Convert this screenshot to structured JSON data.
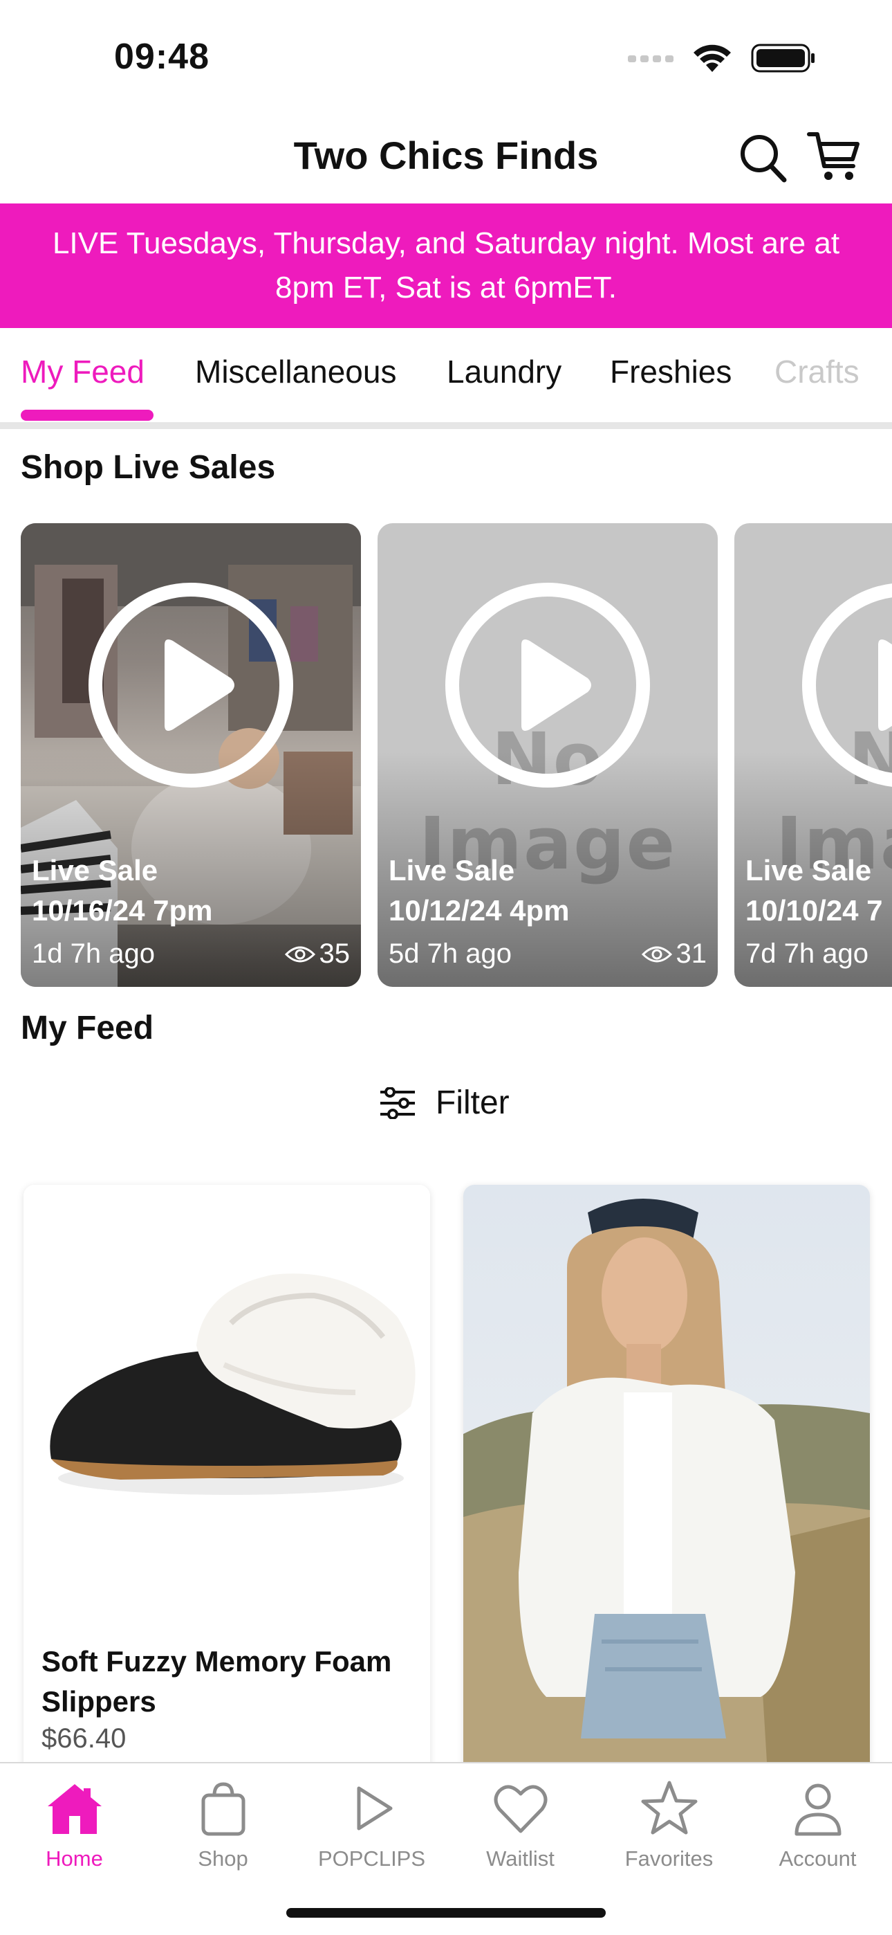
{
  "status_bar": {
    "time": "09:48"
  },
  "header": {
    "title": "Two Chics Finds"
  },
  "banner": {
    "text": "LIVE Tuesdays, Thursday, and Saturday night. Most are at 8pm ET, Sat is at 6pmET."
  },
  "tabs": [
    {
      "label": "My Feed",
      "active": true
    },
    {
      "label": "Miscellaneous"
    },
    {
      "label": "Laundry"
    },
    {
      "label": "Freshies"
    },
    {
      "label": "Crafts"
    }
  ],
  "live_sales": {
    "title": "Shop Live Sales",
    "no_image_text": "No Image",
    "items": [
      {
        "label": "Live Sale",
        "date": "10/16/24 7pm",
        "ago": "1d 7h ago",
        "views": "35",
        "has_image": true
      },
      {
        "label": "Live Sale",
        "date": "10/12/24 4pm",
        "ago": "5d 7h ago",
        "views": "31",
        "has_image": false
      },
      {
        "label": "Live Sale",
        "date": "10/10/24 7",
        "ago": "7d 7h ago",
        "views": "",
        "has_image": false
      }
    ]
  },
  "feed": {
    "title": "My Feed",
    "filter_label": "Filter",
    "products": [
      {
        "name": "Soft Fuzzy Memory Foam Slippers",
        "price": "$66.40"
      },
      {
        "name": "",
        "price": ""
      }
    ]
  },
  "tabbar": [
    {
      "label": "Home",
      "icon": "home-icon",
      "active": true
    },
    {
      "label": "Shop",
      "icon": "shopping-bag-icon"
    },
    {
      "label": "POPCLIPS",
      "icon": "play-icon"
    },
    {
      "label": "Waitlist",
      "icon": "heart-icon"
    },
    {
      "label": "Favorites",
      "icon": "star-icon"
    },
    {
      "label": "Account",
      "icon": "person-icon"
    }
  ],
  "colors": {
    "accent": "#ee1bbd",
    "inactive": "#8c8c8c",
    "no_image_bg": "#c6c6c6"
  }
}
